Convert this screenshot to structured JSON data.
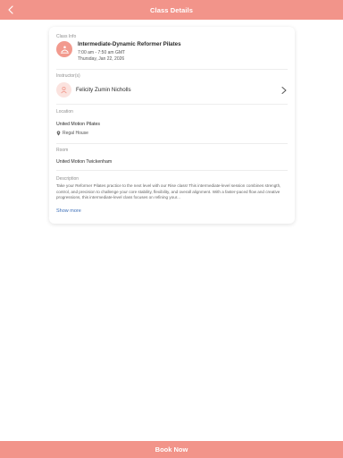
{
  "header": {
    "title": "Class Details"
  },
  "class_info": {
    "label": "Class Info",
    "name": "Intermediate-Dynamic Reformer Pilates",
    "time": "7:00 am - 7:50 am GMT",
    "date": "Thursday, Jan 22, 2026"
  },
  "instructor": {
    "label": "Instructor(s)",
    "name": "Felicity Zumin Nicholls"
  },
  "location": {
    "label": "Location",
    "name": "United Motion Pilates",
    "place": "Regal House"
  },
  "room": {
    "label": "Room",
    "name": "United Motion Twickenham"
  },
  "description": {
    "label": "Description",
    "text": "Take your Reformer Pilates practice to the next level with our Rise class! This intermediate-level session combines strength, control, and precision to challenge your core stability, flexibility, and overall alignment. With a faster-paced flow and creative progressions, this intermediate-level class focuses on refining your...",
    "show_more": "Show more"
  },
  "footer": {
    "book_label": "Book Now"
  },
  "colors": {
    "accent": "#f2948a",
    "link": "#3d6fb8"
  }
}
